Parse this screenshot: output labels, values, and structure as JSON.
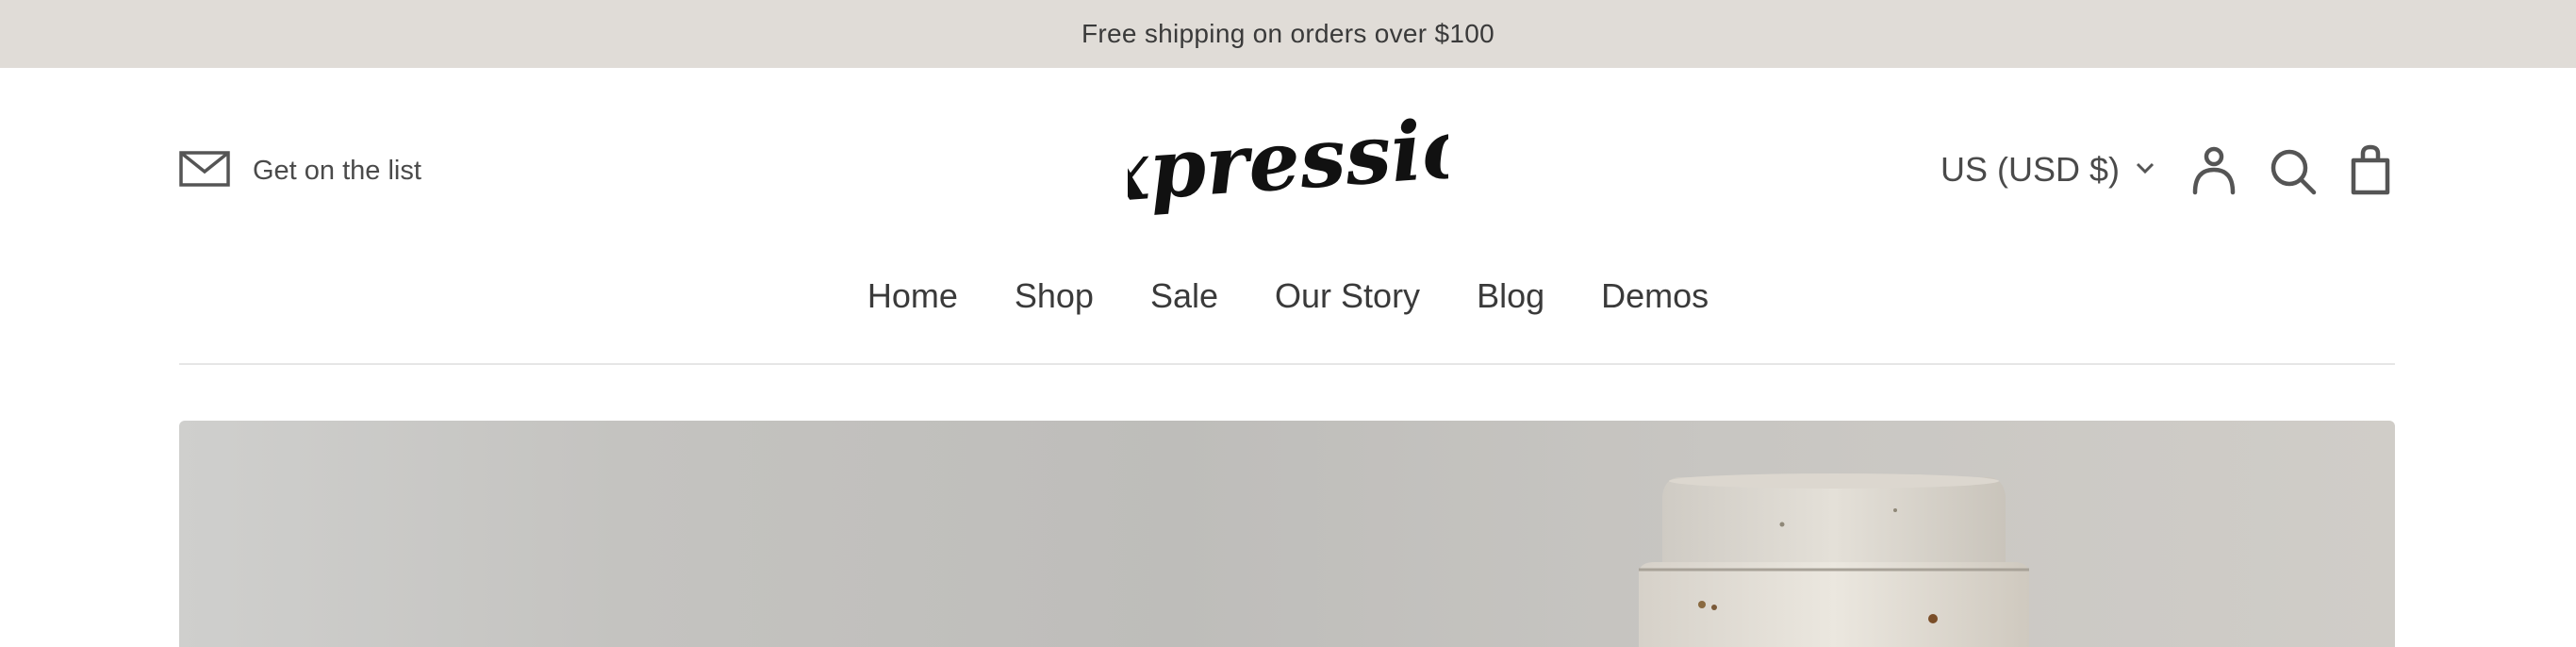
{
  "announcement": {
    "text": "Free shipping on orders over $100"
  },
  "header": {
    "signup_label": "Get on the list",
    "logo_text": "Expression",
    "currency_label": "US (USD $)",
    "icons": [
      "mail-icon",
      "chevron-down-icon",
      "account-icon",
      "search-icon",
      "cart-icon"
    ]
  },
  "nav": {
    "items": [
      {
        "label": "Home"
      },
      {
        "label": "Shop"
      },
      {
        "label": "Sale"
      },
      {
        "label": "Our Story"
      },
      {
        "label": "Blog"
      },
      {
        "label": "Demos"
      }
    ]
  },
  "colors": {
    "announcement_bg": "#e0dcd7",
    "text": "#3a3a3a",
    "hero_bg": "#c4c3c0"
  }
}
